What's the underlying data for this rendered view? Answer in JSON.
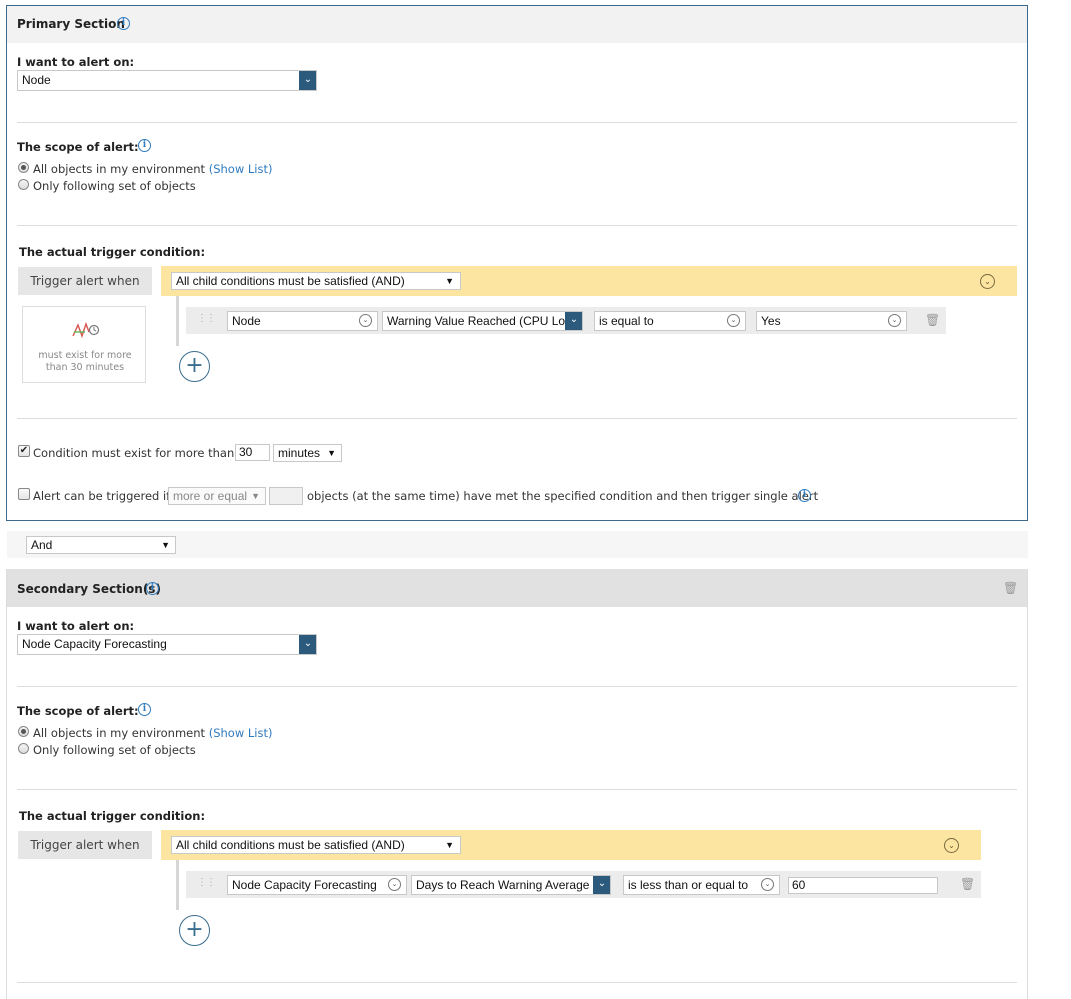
{
  "primary": {
    "title": "Primary Section",
    "alert_on_label": "I want to alert on:",
    "alert_on_value": "Node",
    "scope_label": "The scope of alert:",
    "scope_all": "All objects in my environment",
    "show_list": "(Show List)",
    "scope_following": "Only following set of objects",
    "trigger_heading": "The actual trigger condition:",
    "trigger_when": "Trigger alert when",
    "trigger_mode": "All child conditions must be satisfied (AND)",
    "condition": {
      "object": "Node",
      "field": "Warning Value Reached (CPU Lo",
      "operator": "is equal to",
      "value": "Yes"
    },
    "exist_note": "must exist for more than 30 minutes",
    "exist_label": "Condition must exist for more than",
    "exist_value": "30",
    "exist_unit": "minutes",
    "triggered_if_label": "Alert can be triggered if",
    "more_or_equal": "more or equal",
    "objects_text": "objects (at the same time) have met the specified condition and then trigger single alert"
  },
  "combinator": "And",
  "secondary": {
    "title": "Secondary Section(s)",
    "alert_on_label": "I want to alert on:",
    "alert_on_value": "Node Capacity Forecasting",
    "scope_label": "The scope of alert:",
    "scope_all": "All objects in my environment",
    "show_list": "(Show List)",
    "scope_following": "Only following set of objects",
    "trigger_heading": "The actual trigger condition:",
    "trigger_when": "Trigger alert when",
    "trigger_mode": "All child conditions must be satisfied (AND)",
    "condition": {
      "object": "Node Capacity Forecasting",
      "field": "Days to Reach Warning Average",
      "operator": "is less than or equal to",
      "value": "60"
    }
  },
  "colors": {
    "accent": "#2b5a7c",
    "link": "#2f7bbf",
    "highlight": "#fbe5a0",
    "header_bg": "#e1e1e1"
  }
}
